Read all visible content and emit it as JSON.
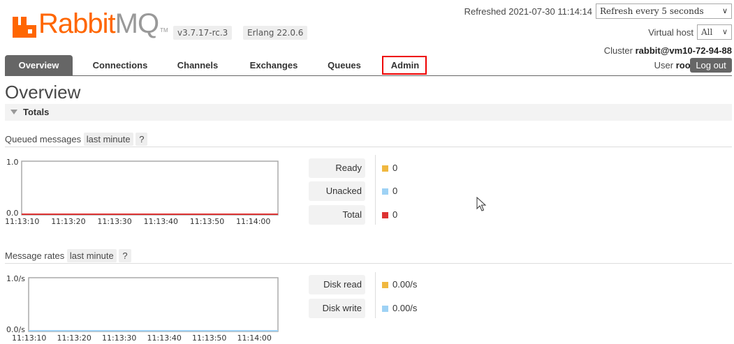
{
  "app": {
    "brand_main": "Rabbit",
    "brand_suffix": "MQ",
    "trademark": "TM",
    "version": "v3.7.17-rc.3",
    "erlang": "Erlang 22.0.6",
    "brand_color": "#ff6600"
  },
  "header": {
    "refreshed": "Refreshed 2021-07-30 11:14:14",
    "refresh_interval": "Refresh every 5 seconds",
    "vhost_label": "Virtual host",
    "vhost_value": "All",
    "cluster_label": "Cluster",
    "cluster_name": "rabbit@vm10-72-94-88",
    "user_label": "User",
    "user_name": "root",
    "logout": "Log out"
  },
  "nav": {
    "tabs": [
      {
        "label": "Overview",
        "active": true
      },
      {
        "label": "Connections"
      },
      {
        "label": "Channels"
      },
      {
        "label": "Exchanges"
      },
      {
        "label": "Queues"
      },
      {
        "label": "Admin",
        "highlighted": true
      }
    ]
  },
  "overview": {
    "title": "Overview",
    "section_title": "Totals",
    "queued": {
      "label": "Queued messages",
      "range": "last minute",
      "help": "?",
      "stats": [
        {
          "label": "Ready",
          "value": "0",
          "color": "#f0b840"
        },
        {
          "label": "Unacked",
          "value": "0",
          "color": "#9ed2f5"
        },
        {
          "label": "Total",
          "value": "0",
          "color": "#dd3333"
        }
      ]
    },
    "rates": {
      "label": "Message rates",
      "range": "last minute",
      "help": "?",
      "stats": [
        {
          "label": "Disk read",
          "value": "0.00/s",
          "color": "#f0b840"
        },
        {
          "label": "Disk write",
          "value": "0.00/s",
          "color": "#9ed2f5"
        }
      ]
    }
  },
  "chart_data": [
    {
      "type": "line",
      "title": "Queued messages",
      "x": [
        "11:13:10",
        "11:13:20",
        "11:13:30",
        "11:13:40",
        "11:13:50",
        "11:14:00"
      ],
      "ylim": [
        0,
        1
      ],
      "y_ticks": [
        "1.0",
        "0.0"
      ],
      "series": [
        {
          "name": "Ready",
          "values": [
            0,
            0,
            0,
            0,
            0,
            0
          ],
          "color": "#f0b840"
        },
        {
          "name": "Unacked",
          "values": [
            0,
            0,
            0,
            0,
            0,
            0
          ],
          "color": "#9ed2f5"
        },
        {
          "name": "Total",
          "values": [
            0,
            0,
            0,
            0,
            0,
            0
          ],
          "color": "#dd3333"
        }
      ]
    },
    {
      "type": "line",
      "title": "Message rates",
      "x": [
        "11:13:10",
        "11:13:20",
        "11:13:30",
        "11:13:40",
        "11:13:50",
        "11:14:00"
      ],
      "ylim": [
        0,
        1
      ],
      "y_ticks": [
        "1.0/s",
        "0.0/s"
      ],
      "series": [
        {
          "name": "Disk read",
          "values": [
            0,
            0,
            0,
            0,
            0,
            0
          ],
          "color": "#f0b840"
        },
        {
          "name": "Disk write",
          "values": [
            0,
            0,
            0,
            0,
            0,
            0
          ],
          "color": "#9ed2f5"
        }
      ]
    }
  ]
}
